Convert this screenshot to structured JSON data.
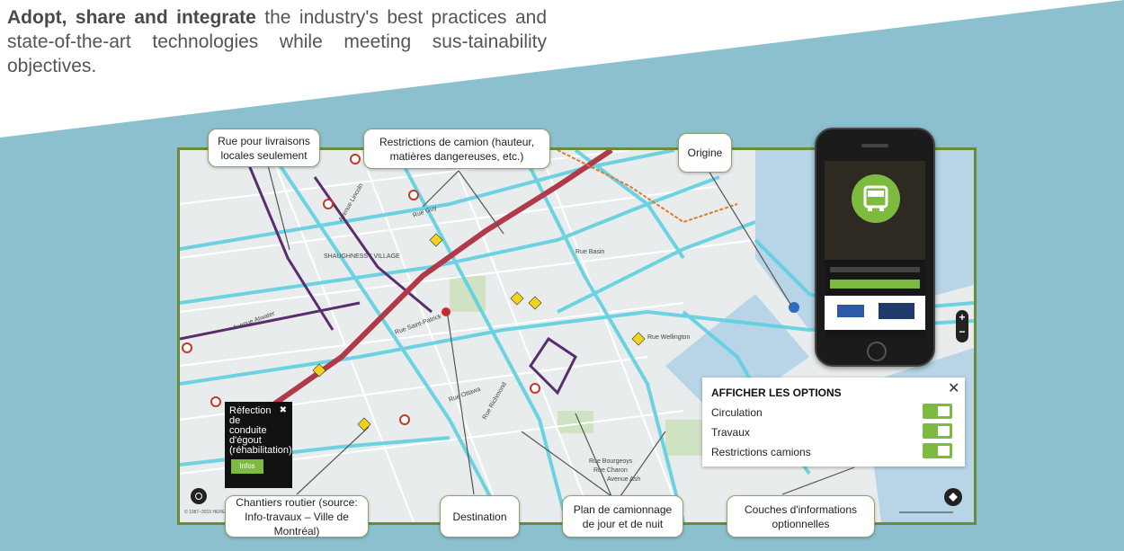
{
  "intro": {
    "bold": "Adopt, share and integrate",
    "rest": " the industry's best practices and state-of-the-art technologies while meeting sus-tainability objectives."
  },
  "colors": {
    "band": "#8dc0cf",
    "accent": "#7dbb3f",
    "frame": "#6b8a3a",
    "route": "#5fd0e0",
    "truck_route": "#5a2d6e"
  },
  "callouts": {
    "rue": "Rue pour livraisons locales seulement",
    "restrictions": "Restrictions de camion (hauteur, matières dangereuses, etc.)",
    "origine": "Origine",
    "chantiers": "Chantiers routier (source: Info-travaux – Ville de Montréal)",
    "destination": "Destination",
    "plan": "Plan de camionnage de jour et de nuit",
    "couches": "Couches d'informations optionnelles"
  },
  "options": {
    "title": "AFFICHER LES OPTIONS",
    "close": "✕",
    "items": [
      "Circulation",
      "Travaux",
      "Restrictions camions"
    ]
  },
  "popup": {
    "title": "Réfection de conduite d'égout (réhabilitation)",
    "close": "✖",
    "button": "Infos"
  },
  "zoom": {
    "plus": "+",
    "minus": "−"
  },
  "map_labels": {
    "l1": "Rue Guy",
    "l2": "Rue Basin",
    "l3": "Avenue Atwater",
    "l4": "Rue Wellington",
    "l5": "Rue Bourgeoys",
    "l6": "Rue Charon",
    "l7": "Avenue Ash",
    "l8": "Rue Saint-Patrick",
    "l9": "SHAUGHNESSY VILLAGE",
    "l10": "Avenue Lincoln",
    "l11": "Rue Richmond",
    "l12": "Rue Ottawa"
  },
  "copyright": "© 1987–2015 HERE"
}
